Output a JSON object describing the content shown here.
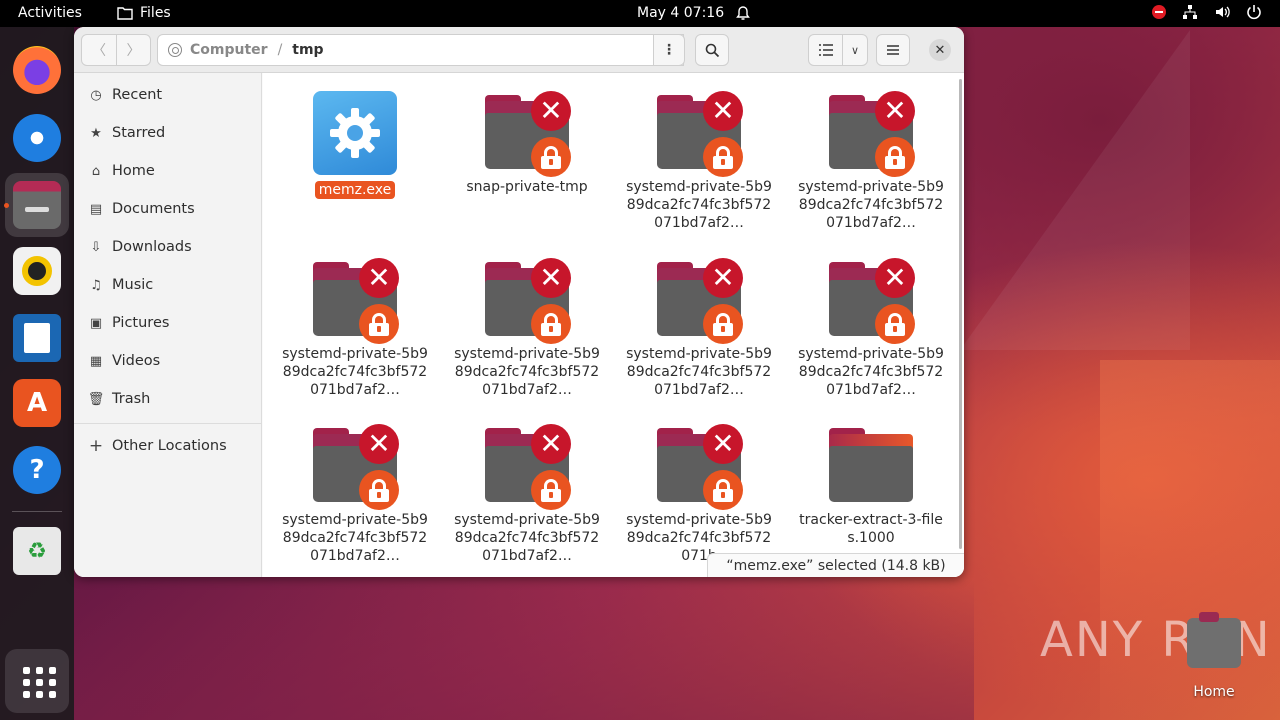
{
  "topbar": {
    "activities": "Activities",
    "app_name": "Files",
    "clock": "May 4  07:16"
  },
  "window": {
    "path_root": "Computer",
    "path_current": "tmp",
    "status": "“memz.exe” selected  (14.8 kB)"
  },
  "sidebar": {
    "items": [
      {
        "label": "Recent",
        "icon": "clock-icon"
      },
      {
        "label": "Starred",
        "icon": "star-icon"
      },
      {
        "label": "Home",
        "icon": "home-icon"
      },
      {
        "label": "Documents",
        "icon": "document-icon"
      },
      {
        "label": "Downloads",
        "icon": "download-icon"
      },
      {
        "label": "Music",
        "icon": "music-icon"
      },
      {
        "label": "Pictures",
        "icon": "picture-icon"
      },
      {
        "label": "Videos",
        "icon": "video-icon"
      },
      {
        "label": "Trash",
        "icon": "trash-icon"
      }
    ],
    "other_locations": "Other Locations"
  },
  "files": [
    {
      "name": "memz.exe",
      "type": "exe",
      "selected": true
    },
    {
      "name": "snap-private-tmp",
      "type": "locked-folder"
    },
    {
      "name": "systemd-private-5b989dca2fc74fc3bf572071bd7af2…",
      "type": "locked-folder"
    },
    {
      "name": "systemd-private-5b989dca2fc74fc3bf572071bd7af2…",
      "type": "locked-folder"
    },
    {
      "name": "systemd-private-5b989dca2fc74fc3bf572071bd7af2…",
      "type": "locked-folder"
    },
    {
      "name": "systemd-private-5b989dca2fc74fc3bf572071bd7af2…",
      "type": "locked-folder"
    },
    {
      "name": "systemd-private-5b989dca2fc74fc3bf572071bd7af2…",
      "type": "locked-folder"
    },
    {
      "name": "systemd-private-5b989dca2fc74fc3bf572071bd7af2…",
      "type": "locked-folder"
    },
    {
      "name": "systemd-private-5b989dca2fc74fc3bf572071bd7af2…",
      "type": "locked-folder"
    },
    {
      "name": "systemd-private-5b989dca2fc74fc3bf572071bd7af2…",
      "type": "locked-folder"
    },
    {
      "name": "systemd-private-5b989dca2fc74fc3bf572071b",
      "type": "locked-folder"
    },
    {
      "name": "tracker-extract-3-files.1000",
      "type": "folder"
    }
  ],
  "desktop": {
    "home_label": "Home",
    "watermark": "ANY RUN"
  },
  "colors": {
    "accent": "#e95420",
    "error_emblem": "#c7162b",
    "folder_tab": "#9c2a53",
    "folder_body": "#5e5e5e"
  }
}
